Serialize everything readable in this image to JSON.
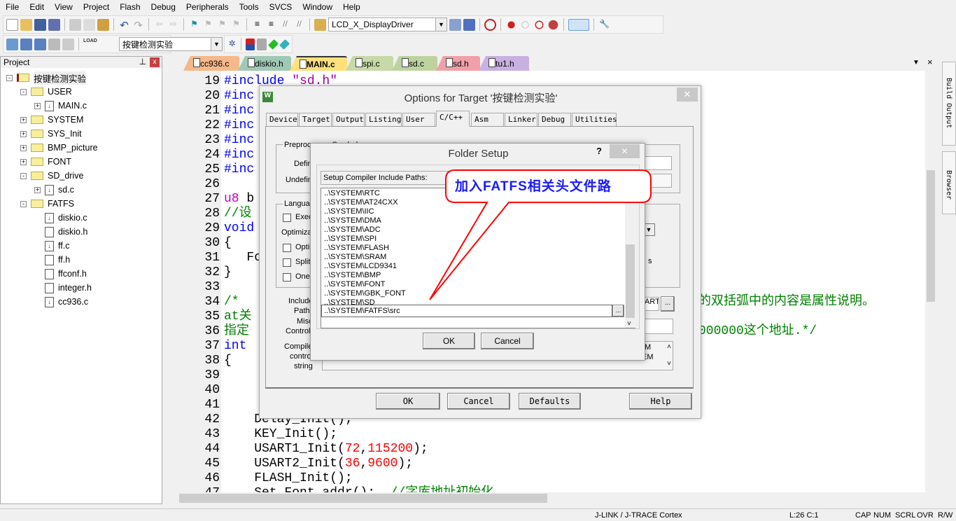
{
  "menu": [
    "File",
    "Edit",
    "View",
    "Project",
    "Flash",
    "Debug",
    "Peripherals",
    "Tools",
    "SVCS",
    "Window",
    "Help"
  ],
  "toolbar": {
    "target_combo": "LCD_X_DisplayDriver",
    "project_combo": "按键检测实验",
    "load_label": "LOAD"
  },
  "project_panel": {
    "title": "Project",
    "tree": [
      {
        "label": "按键检测实验",
        "level": 0,
        "type": "root",
        "expander": "-"
      },
      {
        "label": "USER",
        "level": 1,
        "type": "folder-open",
        "expander": "-"
      },
      {
        "label": "MAIN.c",
        "level": 2,
        "type": "source",
        "expander": "+"
      },
      {
        "label": "SYSTEM",
        "level": 1,
        "type": "folder",
        "expander": "+"
      },
      {
        "label": "SYS_Init",
        "level": 1,
        "type": "folder",
        "expander": "+"
      },
      {
        "label": "BMP_picture",
        "level": 1,
        "type": "folder",
        "expander": "+"
      },
      {
        "label": "FONT",
        "level": 1,
        "type": "folder",
        "expander": "+"
      },
      {
        "label": "SD_drive",
        "level": 1,
        "type": "folder-open",
        "expander": "-"
      },
      {
        "label": "sd.c",
        "level": 2,
        "type": "source",
        "expander": "+"
      },
      {
        "label": "FATFS",
        "level": 1,
        "type": "folder-open",
        "expander": "-"
      },
      {
        "label": "diskio.c",
        "level": 2,
        "type": "source",
        "expander": ""
      },
      {
        "label": "diskio.h",
        "level": 2,
        "type": "header",
        "expander": ""
      },
      {
        "label": "ff.c",
        "level": 2,
        "type": "source",
        "expander": ""
      },
      {
        "label": "ff.h",
        "level": 2,
        "type": "header",
        "expander": ""
      },
      {
        "label": "ffconf.h",
        "level": 2,
        "type": "header",
        "expander": ""
      },
      {
        "label": "integer.h",
        "level": 2,
        "type": "header",
        "expander": ""
      },
      {
        "label": "cc936.c",
        "level": 2,
        "type": "source",
        "expander": ""
      }
    ]
  },
  "file_tabs": [
    {
      "label": "cc936.c",
      "color": "#f5b88a",
      "active": false
    },
    {
      "label": "diskio.h",
      "color": "#9fc9b5",
      "active": false
    },
    {
      "label": "MAIN.c",
      "color": "#ffe07a",
      "active": true
    },
    {
      "label": "spi.c",
      "color": "#c7d9a6",
      "active": false
    },
    {
      "label": "sd.c",
      "color": "#bcd3a0",
      "active": false
    },
    {
      "label": "sd.h",
      "color": "#f0a0a8",
      "active": false
    },
    {
      "label": "tu1.h",
      "color": "#c8b0e0",
      "active": false
    }
  ],
  "code": [
    {
      "n": "19",
      "seg": [
        {
          "t": "#include ",
          "c": "#0000ff"
        },
        {
          "t": "\"sd.h\"",
          "c": "#a000a0"
        }
      ]
    },
    {
      "n": "20",
      "seg": [
        {
          "t": "#inc",
          "c": "#0000ff"
        }
      ]
    },
    {
      "n": "21",
      "seg": [
        {
          "t": "#inc",
          "c": "#0000ff"
        }
      ]
    },
    {
      "n": "22",
      "seg": [
        {
          "t": "#inc",
          "c": "#0000ff"
        }
      ]
    },
    {
      "n": "23",
      "seg": [
        {
          "t": "#inc",
          "c": "#0000ff"
        }
      ]
    },
    {
      "n": "24",
      "seg": [
        {
          "t": "#inc",
          "c": "#0000ff"
        }
      ]
    },
    {
      "n": "25",
      "seg": [
        {
          "t": "#inc",
          "c": "#0000ff"
        }
      ]
    },
    {
      "n": "26",
      "seg": []
    },
    {
      "n": "27",
      "seg": [
        {
          "t": "u8",
          "c": "#c000c0"
        },
        {
          "t": " b",
          "c": "#000000"
        }
      ]
    },
    {
      "n": "28",
      "seg": [
        {
          "t": "//设",
          "c": "#008000"
        }
      ]
    },
    {
      "n": "29",
      "seg": [
        {
          "t": "void",
          "c": "#0000ff"
        }
      ]
    },
    {
      "n": "30",
      "seg": [
        {
          "t": "{",
          "c": "#000000"
        }
      ]
    },
    {
      "n": "31",
      "seg": [
        {
          "t": "   Fo",
          "c": "#000000"
        }
      ]
    },
    {
      "n": "32",
      "seg": [
        {
          "t": "}",
          "c": "#000000"
        }
      ]
    },
    {
      "n": "33",
      "seg": []
    },
    {
      "n": "34",
      "seg": [
        {
          "t": "/*",
          "c": "#008000"
        }
      ],
      "right": "的双括弧中的内容是属性说明。"
    },
    {
      "n": "35",
      "seg": [
        {
          "t": "at关",
          "c": "#008000"
        }
      ]
    },
    {
      "n": "36",
      "seg": [
        {
          "t": "指定",
          "c": "#008000"
        }
      ],
      "right": "000000这个地址.*/"
    },
    {
      "n": "37",
      "seg": [
        {
          "t": "int",
          "c": "#0000ff"
        }
      ]
    },
    {
      "n": "38",
      "seg": [
        {
          "t": "{",
          "c": "#000000"
        }
      ]
    },
    {
      "n": "39",
      "seg": []
    },
    {
      "n": "40",
      "seg": []
    },
    {
      "n": "41",
      "seg": []
    },
    {
      "n": "42",
      "seg": [
        {
          "t": "    Delay_Init();",
          "c": "#000000"
        }
      ]
    },
    {
      "n": "43",
      "seg": [
        {
          "t": "    KEY_Init();",
          "c": "#000000"
        }
      ]
    },
    {
      "n": "44",
      "seg": [
        {
          "t": "    USART1_Init(",
          "c": "#000000"
        },
        {
          "t": "72",
          "c": "#ff0000"
        },
        {
          "t": ",",
          "c": "#000000"
        },
        {
          "t": "115200",
          "c": "#ff0000"
        },
        {
          "t": ");",
          "c": "#000000"
        }
      ]
    },
    {
      "n": "45",
      "seg": [
        {
          "t": "    USART2_Init(",
          "c": "#000000"
        },
        {
          "t": "36",
          "c": "#ff0000"
        },
        {
          "t": ",",
          "c": "#000000"
        },
        {
          "t": "9600",
          "c": "#ff0000"
        },
        {
          "t": ");",
          "c": "#000000"
        }
      ]
    },
    {
      "n": "46",
      "seg": [
        {
          "t": "    FLASH_Init();",
          "c": "#000000"
        }
      ]
    },
    {
      "n": "47",
      "seg": [
        {
          "t": "    Set_Font_addr();  ",
          "c": "#000000"
        },
        {
          "t": "//字库地址初始化",
          "c": "#008000"
        }
      ]
    }
  ],
  "options_dialog": {
    "title": "Options for Target '按键检测实验'",
    "tabs": [
      "Device",
      "Target",
      "Output",
      "Listing",
      "User",
      "C/C++",
      "Asm",
      "Linker",
      "Debug",
      "Utilities"
    ],
    "active_tab": "C/C++",
    "labels": {
      "preproc": "Preprocessor Symbols",
      "define": "Defin",
      "undefine": "Undefin",
      "language": "Languag",
      "exec": "Exec",
      "optimization": "Optimizat",
      "optim": "Optin",
      "split": "Split",
      "one": "One",
      "include": "Include",
      "paths": "Paths",
      "misc": "Misc",
      "controls": "Controls",
      "compiler": "Compile",
      "control": "contro",
      "string": "string",
      "frag_art": "ART",
      "frag_m": "M",
      "frag_em": "EM",
      "frag_s": "s"
    },
    "buttons": {
      "ok": "OK",
      "cancel": "Cancel",
      "defaults": "Defaults",
      "help": "Help",
      "browse": "..."
    }
  },
  "folder_setup": {
    "title": "Folder Setup",
    "help": "?",
    "header": "Setup Compiler Include Paths:",
    "paths": [
      "..\\SYSTEM\\RTC",
      "..\\SYSTEM\\AT24CXX",
      "..\\SYSTEM\\IIC",
      "..\\SYSTEM\\DMA",
      "..\\SYSTEM\\ADC",
      "..\\SYSTEM\\SPI",
      "..\\SYSTEM\\FLASH",
      "..\\SYSTEM\\SRAM",
      "..\\SYSTEM\\LCD9341",
      "..\\SYSTEM\\BMP",
      "..\\SYSTEM\\FONT",
      "..\\SYSTEM\\GBK_FONT",
      "..\\SYSTEM\\SD"
    ],
    "edit_value": "..\\SYSTEM\\FATFS\\src",
    "browse": "...",
    "ok": "OK",
    "cancel": "Cancel"
  },
  "callout": {
    "text": "加入FATFS相关头文件路",
    "color": "#ff0000"
  },
  "side_tabs": [
    "Build Output",
    "Browser"
  ],
  "status": {
    "debugger": "J-LINK / J-TRACE Cortex",
    "position": "L:26 C:1",
    "flags": [
      "CAP",
      "NUM",
      "SCRL",
      "OVR",
      "R/W"
    ]
  }
}
